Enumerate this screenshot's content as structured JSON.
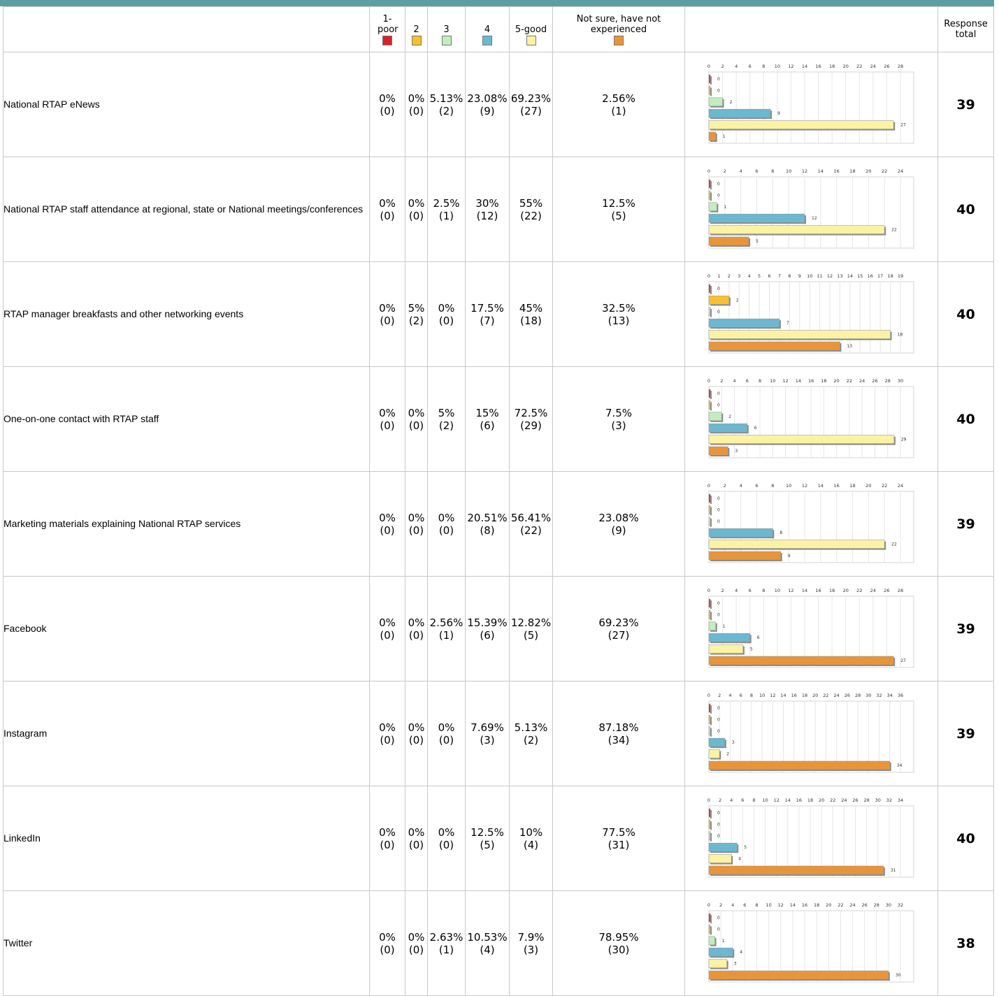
{
  "columns": {
    "c1": "1-poor",
    "c2": "2",
    "c3": "3",
    "c4": "4",
    "c5": "5-good",
    "c6": "Not sure, have not experienced",
    "total": "Response total"
  },
  "colors": {
    "c1": "#d92126",
    "c2": "#fbc02d",
    "c3": "#c3ecbf",
    "c4": "#6bb8d0",
    "c5": "#fbf3a3",
    "c6": "#e8953a"
  },
  "rows": [
    {
      "label": "National RTAP eNews",
      "pct": [
        "0%",
        "0%",
        "5.13%",
        "23.08%",
        "69.23%",
        "2.56%"
      ],
      "cnt": [
        "(0)",
        "(0)",
        "(2)",
        "(9)",
        "(27)",
        "(1)"
      ],
      "total": "39"
    },
    {
      "label": "National RTAP staff attendance at regional, state or National meetings/conferences",
      "pct": [
        "0%",
        "0%",
        "2.5%",
        "30%",
        "55%",
        "12.5%"
      ],
      "cnt": [
        "(0)",
        "(0)",
        "(1)",
        "(12)",
        "(22)",
        "(5)"
      ],
      "total": "40"
    },
    {
      "label": "RTAP manager breakfasts and other networking events",
      "pct": [
        "0%",
        "5%",
        "0%",
        "17.5%",
        "45%",
        "32.5%"
      ],
      "cnt": [
        "(0)",
        "(2)",
        "(0)",
        "(7)",
        "(18)",
        "(13)"
      ],
      "total": "40"
    },
    {
      "label": "One-on-one contact with RTAP staff",
      "pct": [
        "0%",
        "0%",
        "5%",
        "15%",
        "72.5%",
        "7.5%"
      ],
      "cnt": [
        "(0)",
        "(0)",
        "(2)",
        "(6)",
        "(29)",
        "(3)"
      ],
      "total": "40"
    },
    {
      "label": "Marketing materials explaining National RTAP services",
      "pct": [
        "0%",
        "0%",
        "0%",
        "20.51%",
        "56.41%",
        "23.08%"
      ],
      "cnt": [
        "(0)",
        "(0)",
        "(0)",
        "(8)",
        "(22)",
        "(9)"
      ],
      "total": "39"
    },
    {
      "label": "Facebook",
      "pct": [
        "0%",
        "0%",
        "2.56%",
        "15.39%",
        "12.82%",
        "69.23%"
      ],
      "cnt": [
        "(0)",
        "(0)",
        "(1)",
        "(6)",
        "(5)",
        "(27)"
      ],
      "total": "39"
    },
    {
      "label": "Instagram",
      "pct": [
        "0%",
        "0%",
        "0%",
        "7.69%",
        "5.13%",
        "87.18%"
      ],
      "cnt": [
        "(0)",
        "(0)",
        "(0)",
        "(3)",
        "(2)",
        "(34)"
      ],
      "total": "39"
    },
    {
      "label": "LinkedIn",
      "pct": [
        "0%",
        "0%",
        "0%",
        "12.5%",
        "10%",
        "77.5%"
      ],
      "cnt": [
        "(0)",
        "(0)",
        "(0)",
        "(5)",
        "(4)",
        "(31)"
      ],
      "total": "40"
    },
    {
      "label": "Twitter",
      "pct": [
        "0%",
        "0%",
        "2.63%",
        "10.53%",
        "7.9%",
        "78.95%"
      ],
      "cnt": [
        "(0)",
        "(0)",
        "(1)",
        "(4)",
        "(3)",
        "(30)"
      ],
      "total": "38"
    }
  ],
  "chart_data": [
    {
      "type": "bar",
      "values": [
        0,
        0,
        2,
        9,
        27,
        1
      ],
      "ticks": [
        "0",
        "2",
        "4",
        "6",
        "8",
        "10",
        "12",
        "14",
        "16",
        "18",
        "20",
        "22",
        "24",
        "26",
        "28"
      ],
      "xlim": [
        0,
        28
      ],
      "grid": true
    },
    {
      "type": "bar",
      "values": [
        0,
        0,
        1,
        12,
        22,
        5
      ],
      "ticks": [
        "0",
        "2",
        "4",
        "6",
        "8",
        "10",
        "12",
        "14",
        "16",
        "18",
        "20",
        "22",
        "24"
      ],
      "xlim": [
        0,
        24
      ],
      "grid": true
    },
    {
      "type": "bar",
      "values": [
        0,
        2,
        0,
        7,
        18,
        13
      ],
      "ticks": [
        "0",
        "1",
        "2",
        "3",
        "4",
        "5",
        "6",
        "7",
        "8",
        "9",
        "10",
        "11",
        "12",
        "13",
        "14",
        "15",
        "16",
        "17",
        "18",
        "19"
      ],
      "xlim": [
        0,
        19
      ],
      "grid": true
    },
    {
      "type": "bar",
      "values": [
        0,
        0,
        2,
        6,
        29,
        3
      ],
      "ticks": [
        "0",
        "2",
        "4",
        "6",
        "8",
        "10",
        "12",
        "14",
        "16",
        "18",
        "20",
        "22",
        "24",
        "26",
        "28",
        "30"
      ],
      "xlim": [
        0,
        30
      ],
      "grid": true
    },
    {
      "type": "bar",
      "values": [
        0,
        0,
        0,
        8,
        22,
        9
      ],
      "ticks": [
        "0",
        "2",
        "4",
        "6",
        "8",
        "10",
        "12",
        "14",
        "16",
        "18",
        "20",
        "22",
        "24"
      ],
      "xlim": [
        0,
        24
      ],
      "grid": true
    },
    {
      "type": "bar",
      "values": [
        0,
        0,
        1,
        6,
        5,
        27
      ],
      "ticks": [
        "0",
        "2",
        "4",
        "6",
        "8",
        "10",
        "12",
        "14",
        "16",
        "18",
        "20",
        "22",
        "24",
        "26",
        "28"
      ],
      "xlim": [
        0,
        28
      ],
      "grid": true
    },
    {
      "type": "bar",
      "values": [
        0,
        0,
        0,
        3,
        2,
        34
      ],
      "ticks": [
        "0",
        "2",
        "4",
        "6",
        "8",
        "10",
        "12",
        "14",
        "16",
        "18",
        "20",
        "22",
        "24",
        "26",
        "28",
        "30",
        "32",
        "34",
        "36"
      ],
      "xlim": [
        0,
        36
      ],
      "grid": true
    },
    {
      "type": "bar",
      "values": [
        0,
        0,
        0,
        5,
        4,
        31
      ],
      "ticks": [
        "0",
        "2",
        "4",
        "6",
        "8",
        "10",
        "12",
        "14",
        "16",
        "18",
        "20",
        "22",
        "24",
        "26",
        "28",
        "30",
        "32",
        "34"
      ],
      "xlim": [
        0,
        34
      ],
      "grid": true
    },
    {
      "type": "bar",
      "values": [
        0,
        0,
        1,
        4,
        3,
        30
      ],
      "ticks": [
        "0",
        "2",
        "4",
        "6",
        "8",
        "10",
        "12",
        "14",
        "16",
        "18",
        "20",
        "22",
        "24",
        "26",
        "28",
        "30",
        "32"
      ],
      "xlim": [
        0,
        32
      ],
      "grid": true
    }
  ]
}
